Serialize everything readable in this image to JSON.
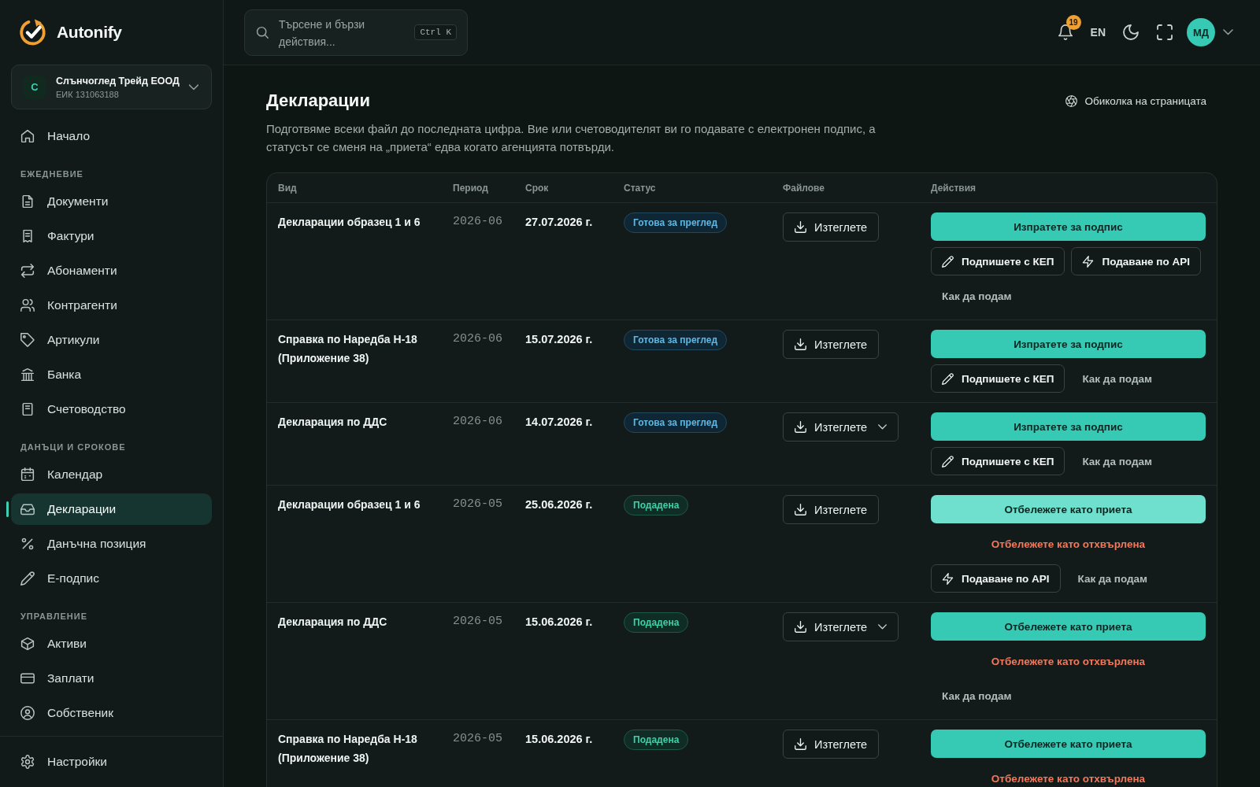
{
  "sidebar": {
    "brand": "Autonify",
    "company": {
      "initial": "С",
      "name": "Слънчоглед Трейд ЕООД",
      "eik": "ЕИК 131063188"
    },
    "groups": [
      {
        "items": [
          {
            "label": "Начало",
            "selected": false
          }
        ]
      },
      {
        "heading": "ЕЖЕДНЕВИЕ",
        "items": [
          {
            "label": "Документи",
            "selected": false
          },
          {
            "label": "Фактури",
            "selected": false
          },
          {
            "label": "Абонаменти",
            "selected": false
          },
          {
            "label": "Контрагенти",
            "selected": false
          },
          {
            "label": "Артикули",
            "selected": false
          },
          {
            "label": "Банка",
            "selected": false
          },
          {
            "label": "Счетоводство",
            "selected": false
          }
        ]
      },
      {
        "heading": "ДАНЪЦИ И СРОКОВЕ",
        "items": [
          {
            "label": "Календар",
            "selected": false
          },
          {
            "label": "Декларации",
            "selected": true
          },
          {
            "label": "Данъчна позиция",
            "selected": false
          },
          {
            "label": "Е-подпис",
            "selected": false
          }
        ]
      },
      {
        "heading": "УПРАВЛЕНИЕ",
        "items": [
          {
            "label": "Активи",
            "selected": false
          },
          {
            "label": "Заплати",
            "selected": false
          },
          {
            "label": "Собственик",
            "selected": false
          }
        ]
      }
    ],
    "footer_items": [
      {
        "label": "Настройки",
        "selected": false
      }
    ]
  },
  "topbar": {
    "search": {
      "placeholder": "Търсене и бързи действия...",
      "shortcut": "Ctrl K"
    },
    "notifications": {
      "count": "19"
    },
    "language": "EN",
    "user": {
      "initials": "МД"
    }
  },
  "page": {
    "title": "Декларации",
    "description": "Подготвяме всеки файл до последната цифра. Вие или счетоводителят ви го подавате с електронен подпис, а статусът се сменя на „приета“ едва когато агенцията потвърди.",
    "tour_link": "Обиколка на страницата"
  },
  "table": {
    "columns": [
      "Вид",
      "Период",
      "Срок",
      "Статус",
      "Файлове",
      "Действия"
    ],
    "rows": [
      {
        "name": "Декларации образец 1 и 6",
        "period": "2026-06",
        "deadline": "27.07.2026 г.",
        "status": {
          "label": "Готова за преглед",
          "kind": "review"
        },
        "file": {
          "label": "Изтеглете",
          "dropdown": false
        },
        "actions": [
          {
            "kind": "primary",
            "label": "Изпратете за подпис",
            "hovered": false
          },
          {
            "kind": "sign",
            "label": "Подпишете с КЕП"
          },
          {
            "kind": "api",
            "label": "Подаване по API"
          },
          {
            "kind": "link",
            "label": "Как да подам"
          }
        ]
      },
      {
        "name": "Справка по Наредба Н-18 (Приложение 38)",
        "period": "2026-06",
        "deadline": "15.07.2026 г.",
        "status": {
          "label": "Готова за преглед",
          "kind": "review"
        },
        "file": {
          "label": "Изтеглете",
          "dropdown": false
        },
        "actions": [
          {
            "kind": "primary",
            "label": "Изпратете за подпис",
            "hovered": false
          },
          {
            "kind": "sign",
            "label": "Подпишете с КЕП"
          },
          {
            "kind": "link",
            "label": "Как да подам"
          }
        ]
      },
      {
        "name": "Декларация по ДДС",
        "period": "2026-06",
        "deadline": "14.07.2026 г.",
        "status": {
          "label": "Готова за преглед",
          "kind": "review"
        },
        "file": {
          "label": "Изтеглете",
          "dropdown": true
        },
        "actions": [
          {
            "kind": "primary",
            "label": "Изпратете за подпис",
            "hovered": false
          },
          {
            "kind": "sign",
            "label": "Подпишете с КЕП"
          },
          {
            "kind": "link",
            "label": "Как да подам"
          }
        ]
      },
      {
        "name": "Декларации образец 1 и 6",
        "period": "2026-05",
        "deadline": "25.06.2026 г.",
        "status": {
          "label": "Подадена",
          "kind": "filed"
        },
        "file": {
          "label": "Изтеглете",
          "dropdown": false
        },
        "actions": [
          {
            "kind": "primary",
            "label": "Отбележете като приета",
            "hovered": true
          },
          {
            "kind": "danger",
            "label": "Отбележете като отхвърлена"
          },
          {
            "kind": "api",
            "label": "Подаване по API"
          },
          {
            "kind": "link",
            "label": "Как да подам"
          }
        ]
      },
      {
        "name": "Декларация по ДДС",
        "period": "2026-05",
        "deadline": "15.06.2026 г.",
        "status": {
          "label": "Подадена",
          "kind": "filed"
        },
        "file": {
          "label": "Изтеглете",
          "dropdown": true
        },
        "actions": [
          {
            "kind": "primary",
            "label": "Отбележете като приета",
            "hovered": false
          },
          {
            "kind": "danger",
            "label": "Отбележете като отхвърлена"
          },
          {
            "kind": "link",
            "label": "Как да подам"
          }
        ]
      },
      {
        "name": "Справка по Наредба Н-18 (Приложение 38)",
        "period": "2026-05",
        "deadline": "15.06.2026 г.",
        "status": {
          "label": "Подадена",
          "kind": "filed"
        },
        "file": {
          "label": "Изтеглете",
          "dropdown": false
        },
        "actions": [
          {
            "kind": "primary",
            "label": "Отбележете като приета",
            "hovered": false
          },
          {
            "kind": "danger",
            "label": "Отбележете като отхвърлена"
          }
        ]
      }
    ]
  }
}
